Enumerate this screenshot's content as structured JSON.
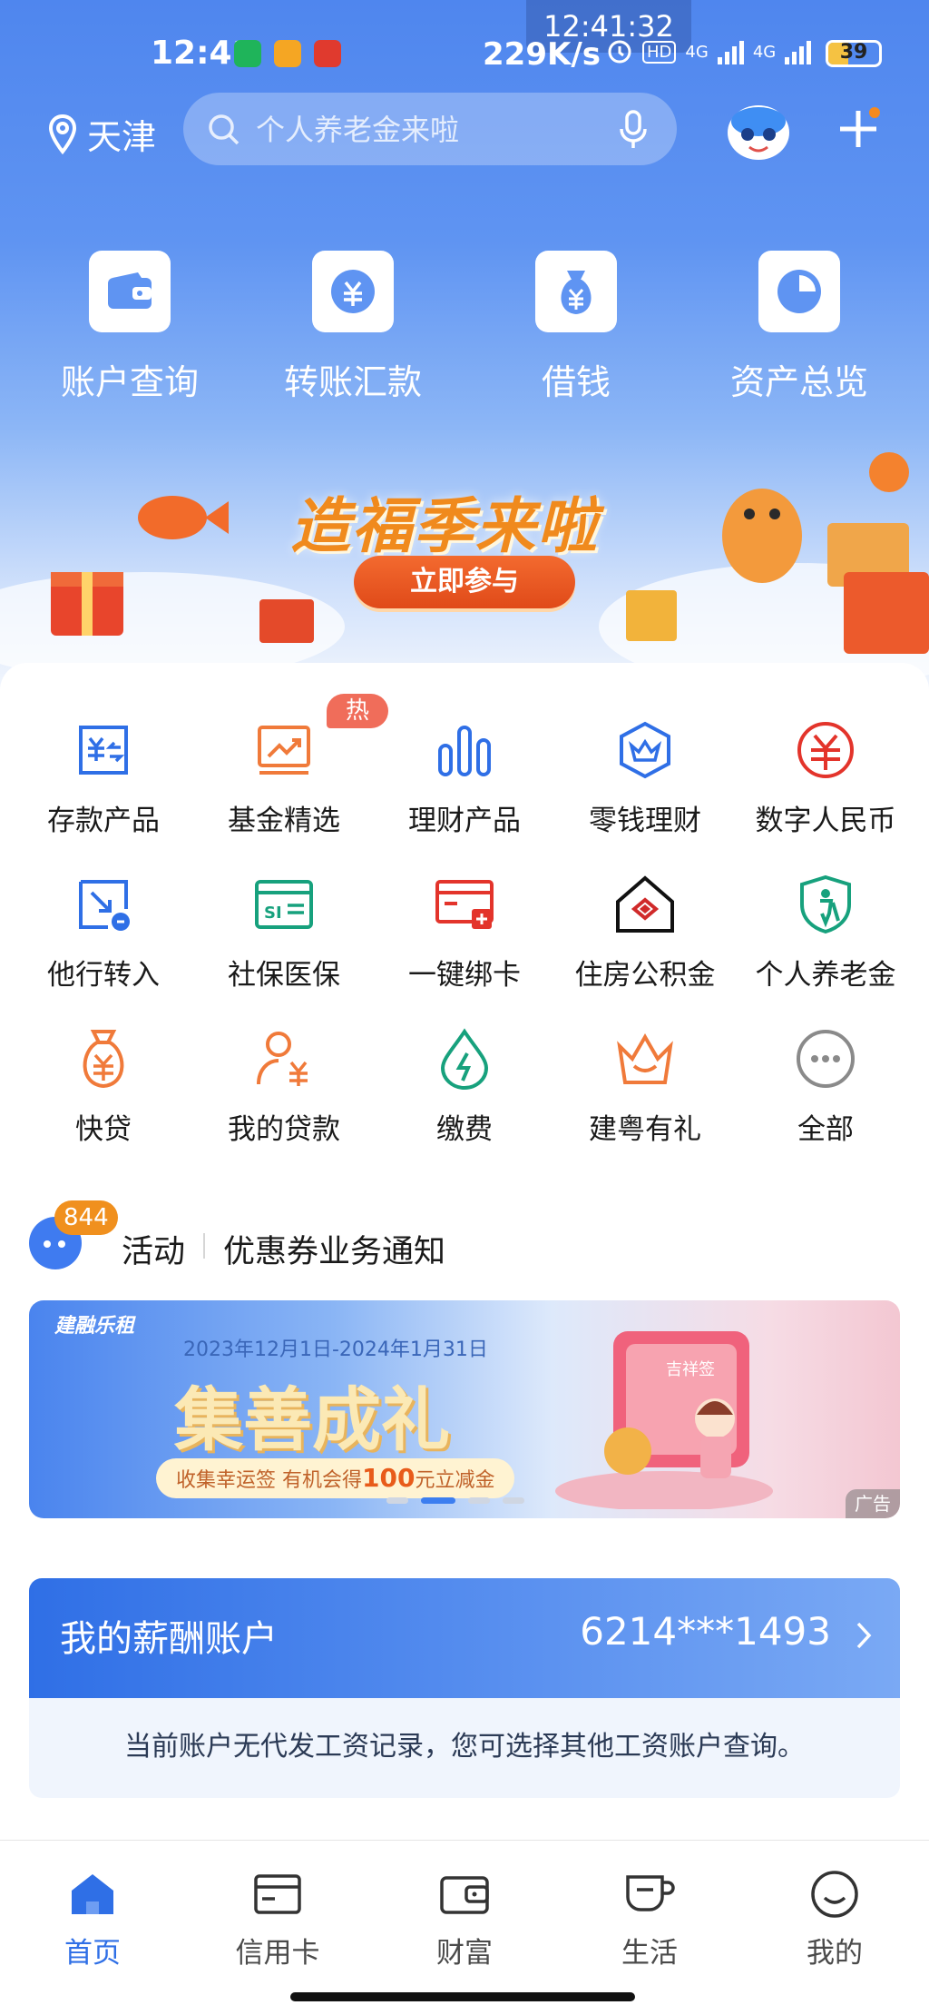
{
  "status_bar": {
    "time": "12:41",
    "float_time": "12:41:32",
    "net_speed": "229K/s",
    "hd_label": "HD",
    "net_type_1": "4G",
    "net_type_2": "4G",
    "battery": "39"
  },
  "header": {
    "city": "天津",
    "search_placeholder": "个人养老金来啦"
  },
  "quick_actions": [
    {
      "label": "账户查询",
      "icon": "wallet-icon"
    },
    {
      "label": "转账汇款",
      "icon": "transfer-yuan-icon"
    },
    {
      "label": "借钱",
      "icon": "money-bag-icon"
    },
    {
      "label": "资产总览",
      "icon": "pie-chart-icon"
    }
  ],
  "banner": {
    "title": "造福季来啦",
    "button": "立即参与"
  },
  "services": [
    {
      "label": "存款产品",
      "icon": "deposit-icon"
    },
    {
      "label": "基金精选",
      "icon": "fund-chart-icon",
      "badge": "热"
    },
    {
      "label": "理财产品",
      "icon": "bar-chart-icon"
    },
    {
      "label": "零钱理财",
      "icon": "crown-shield-icon"
    },
    {
      "label": "数字人民币",
      "icon": "digital-yuan-icon"
    },
    {
      "label": "他行转入",
      "icon": "transfer-in-icon"
    },
    {
      "label": "社保医保",
      "icon": "social-security-card-icon"
    },
    {
      "label": "一键绑卡",
      "icon": "bind-card-icon"
    },
    {
      "label": "住房公积金",
      "icon": "housing-fund-icon"
    },
    {
      "label": "个人养老金",
      "icon": "pension-shield-icon"
    },
    {
      "label": "快贷",
      "icon": "quick-loan-bag-icon"
    },
    {
      "label": "我的贷款",
      "icon": "my-loan-person-icon"
    },
    {
      "label": "缴费",
      "icon": "payment-drop-icon"
    },
    {
      "label": "建粤有礼",
      "icon": "gift-crown-icon"
    },
    {
      "label": "全部",
      "icon": "more-dots-icon"
    }
  ],
  "activity": {
    "badge_count": "844",
    "tag": "活动",
    "text": "优惠券业务通知"
  },
  "promo": {
    "brand": "建融乐租",
    "date": "2023年12月1日-2024年1月31日",
    "title": "集善成礼",
    "sub_prefix": "收集幸运签 有机会得",
    "sub_amount": "100",
    "sub_suffix": "元立减金",
    "ad_label": "广告",
    "card_label": "吉祥签"
  },
  "salary": {
    "title": "我的薪酬账户",
    "account": "6214***1493",
    "note": "当前账户无代发工资记录，您可选择其他工资账户查询。"
  },
  "tabbar": [
    {
      "label": "首页",
      "icon": "home-icon",
      "active": true
    },
    {
      "label": "信用卡",
      "icon": "credit-card-icon"
    },
    {
      "label": "财富",
      "icon": "wealth-wallet-icon"
    },
    {
      "label": "生活",
      "icon": "life-cup-icon"
    },
    {
      "label": "我的",
      "icon": "smile-face-icon"
    }
  ],
  "colors": {
    "brand_blue": "#2f6fe6",
    "hero_top": "#4f86ee",
    "hot_badge": "#f06d5a",
    "orange_accent": "#f0901e"
  }
}
